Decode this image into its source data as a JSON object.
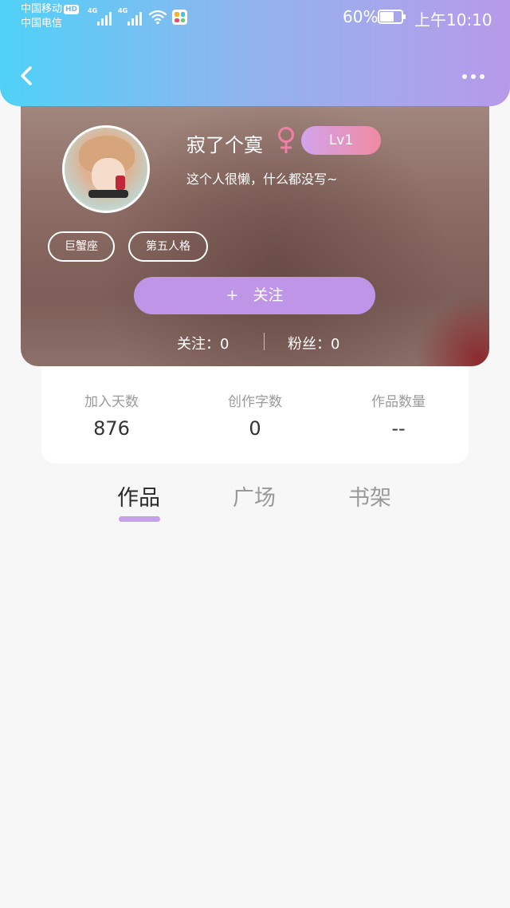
{
  "status_bar": {
    "carrier_1": "中国移动",
    "hd": "HD",
    "carrier_2": "中国电信",
    "net_1": "4G",
    "net_2": "4G",
    "battery_percent": "60%",
    "time": "上午10:10"
  },
  "nav": {
    "back_icon": "chevron-left-icon",
    "more_icon": "more-dots-icon"
  },
  "profile": {
    "username": "寂了个寞",
    "gender_icon": "female-symbol-icon",
    "level": "Lv1",
    "bio": "这个人很懒，什么都没写~",
    "tags": [
      "巨蟹座",
      "第五人格"
    ],
    "follow_button": {
      "plus": "+",
      "label": "关注"
    },
    "following": "关注：0",
    "followers": "粉丝：0"
  },
  "stats": [
    {
      "label": "加入天数",
      "value": "876"
    },
    {
      "label": "创作字数",
      "value": "0"
    },
    {
      "label": "作品数量",
      "value": "--"
    }
  ],
  "tabs": [
    {
      "label": "作品",
      "active": true
    },
    {
      "label": "广场",
      "active": false
    },
    {
      "label": "书架",
      "active": false
    }
  ],
  "colors": {
    "header_gradient_start": "#4fd1f7",
    "header_gradient_end": "#b79ae9",
    "accent_purple": "#bf96e7",
    "level_gradient_end": "#f08aa2",
    "gender_pink": "#f07fa3"
  }
}
